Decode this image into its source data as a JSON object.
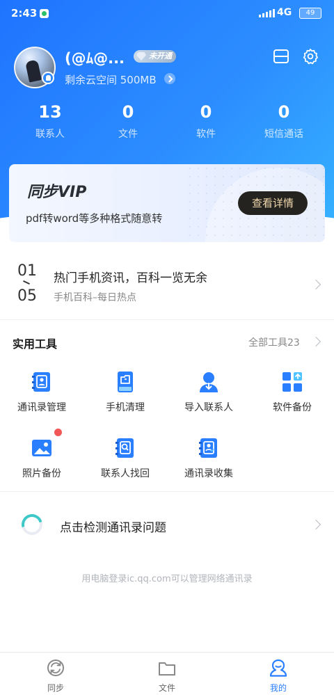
{
  "status_bar": {
    "time": "2:43",
    "network": "4G",
    "battery": "49"
  },
  "profile": {
    "nickname": "(@ﾑ@...",
    "vip_status": "未开通",
    "storage_text": "剩余云空间 500MB"
  },
  "stats": [
    {
      "value": "13",
      "label": "联系人"
    },
    {
      "value": "0",
      "label": "文件"
    },
    {
      "value": "0",
      "label": "软件"
    },
    {
      "value": "0",
      "label": "短信通话"
    }
  ],
  "vip_card": {
    "title": "同步VIP",
    "description": "pdf转word等多种格式随意转",
    "button": "查看详情"
  },
  "news": {
    "month": "01",
    "day": "05",
    "title": "热门手机资讯，百科一览无余",
    "subtitle": "手机百科–每日热点"
  },
  "tools": {
    "title": "实用工具",
    "all_label": "全部工具23",
    "items": [
      {
        "label": "通讯录管理",
        "icon": "contacts-book-icon"
      },
      {
        "label": "手机清理",
        "icon": "phone-clean-icon"
      },
      {
        "label": "导入联系人",
        "icon": "import-contact-icon"
      },
      {
        "label": "软件备份",
        "icon": "app-backup-icon"
      },
      {
        "label": "照片备份",
        "icon": "photo-backup-icon"
      },
      {
        "label": "联系人找回",
        "icon": "contact-recover-icon"
      },
      {
        "label": "通讯录收集",
        "icon": "contacts-collect-icon"
      }
    ]
  },
  "detect": {
    "text": "点击检测通讯录问题"
  },
  "footer_tip": "用电脑登录ic.qq.com可以管理网络通讯录",
  "bottom_nav": [
    {
      "label": "同步",
      "icon": "sync-icon",
      "active": false
    },
    {
      "label": "文件",
      "icon": "folder-icon",
      "active": false
    },
    {
      "label": "我的",
      "icon": "profile-icon",
      "active": true
    }
  ],
  "colors": {
    "primary": "#2a7fff",
    "vip_button_bg": "#24231f",
    "vip_button_text": "#f1d8ad",
    "badge_red": "#f25757"
  }
}
